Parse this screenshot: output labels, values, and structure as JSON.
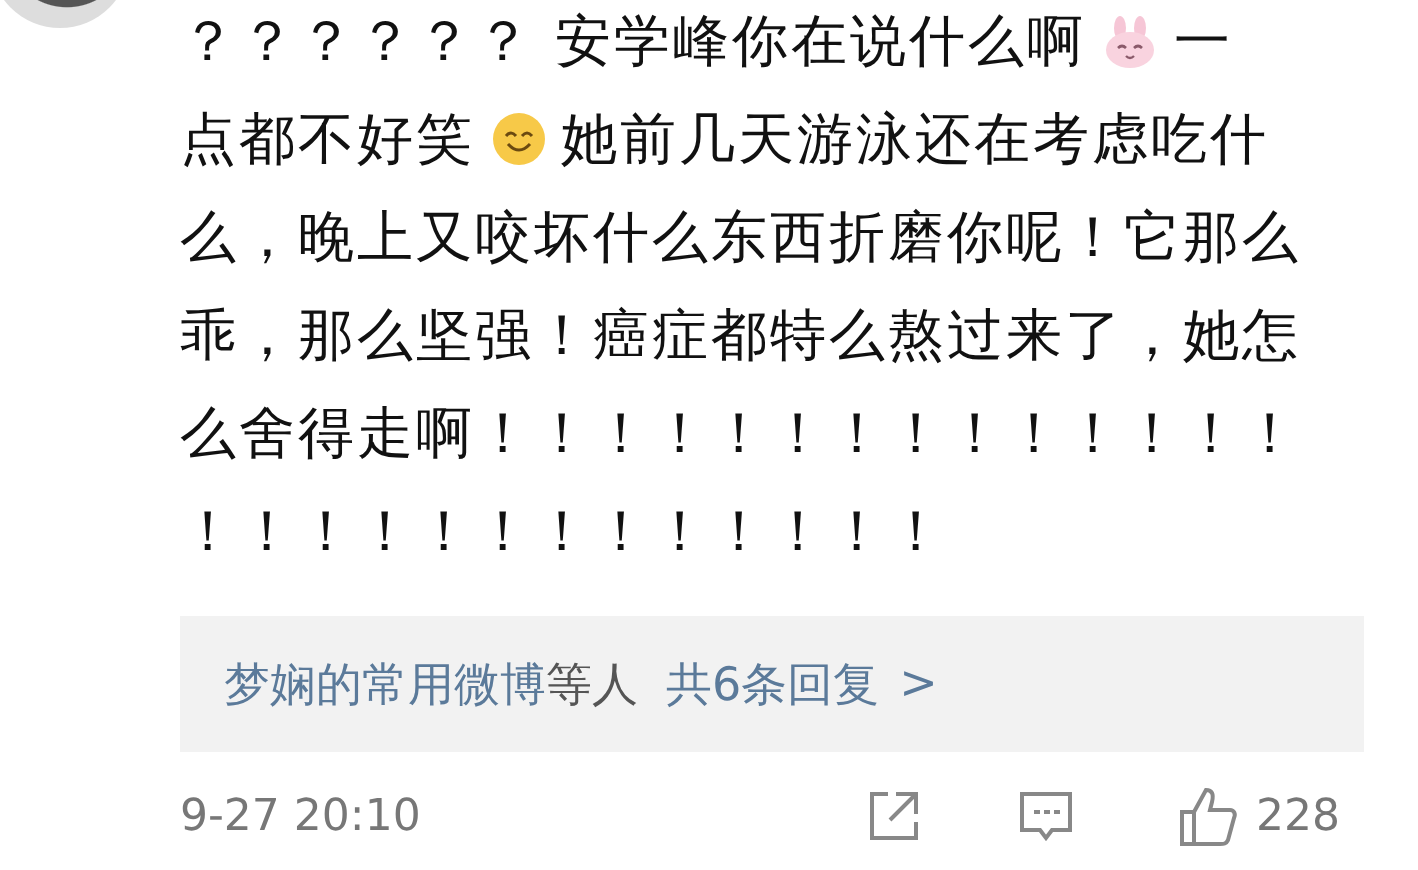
{
  "comment": {
    "lines": [
      [
        {
          "kind": "text",
          "text": "？？？？？？ 安学峰你在说什么啊"
        },
        {
          "kind": "bunny"
        },
        {
          "kind": "text",
          "text": "一"
        }
      ],
      [
        {
          "kind": "text",
          "text": "点都不好笑"
        },
        {
          "kind": "smiley"
        },
        {
          "kind": "text",
          "text": "她前几天游泳还在考虑吃什"
        }
      ],
      [
        {
          "kind": "text",
          "text": "么，晚上又咬坏什么东西折磨你呢！它那么"
        }
      ],
      [
        {
          "kind": "text",
          "text": "乖，那么坚强！癌症都特么熬过来了，她怎"
        }
      ],
      [
        {
          "kind": "text",
          "text": "么舍得走啊！！！！！！！！！！！！！！"
        }
      ],
      [
        {
          "kind": "text",
          "text": "！！！！！！！！！！！！！"
        }
      ]
    ]
  },
  "replies": {
    "parts": [
      {
        "kind": "link",
        "text": "梦娴的常用微博"
      },
      {
        "kind": "plain",
        "text": "等人"
      },
      {
        "kind": "link",
        "text": "共6条回复"
      },
      {
        "kind": "chevron",
        "text": ">"
      }
    ]
  },
  "footer": {
    "time": "9-27 20:10",
    "likes": "228"
  }
}
